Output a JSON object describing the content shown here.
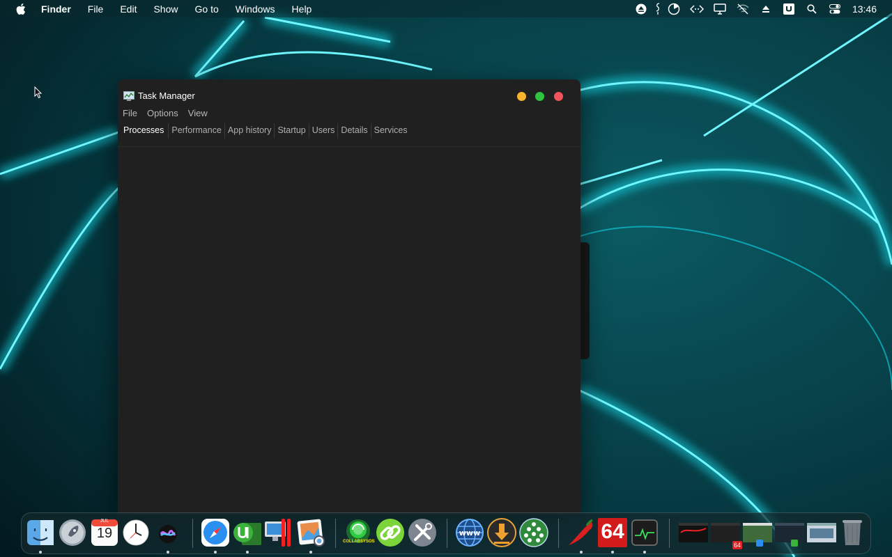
{
  "menubar": {
    "app_name": "Finder",
    "items": [
      "File",
      "Edit",
      "Show",
      "Go to",
      "Windows",
      "Help"
    ],
    "clock": "13:46",
    "status_icons": [
      "eject-icon",
      "script-icon",
      "timer-icon",
      "code-icon",
      "display-icon",
      "wifi-off-icon",
      "upload-icon",
      "u-app-icon",
      "search-icon",
      "control-center-icon"
    ]
  },
  "window": {
    "title": "Task Manager",
    "menu": [
      "File",
      "Options",
      "View"
    ],
    "tabs": [
      "Processes",
      "Performance",
      "App history",
      "Startup",
      "Users",
      "Details",
      "Services"
    ],
    "active_tab": "Processes"
  },
  "dock": {
    "calendar_month": "JUL",
    "calendar_day": "19",
    "sixty_four": "64",
    "badge_64": "64",
    "collabsys_label": "COLLABSYSOS"
  },
  "colors": {
    "accent_cyan": "#00e5f0",
    "window_bg": "#202020",
    "traffic_min": "#f7b42c",
    "traffic_max": "#2ec43f",
    "traffic_close": "#f2545b"
  }
}
